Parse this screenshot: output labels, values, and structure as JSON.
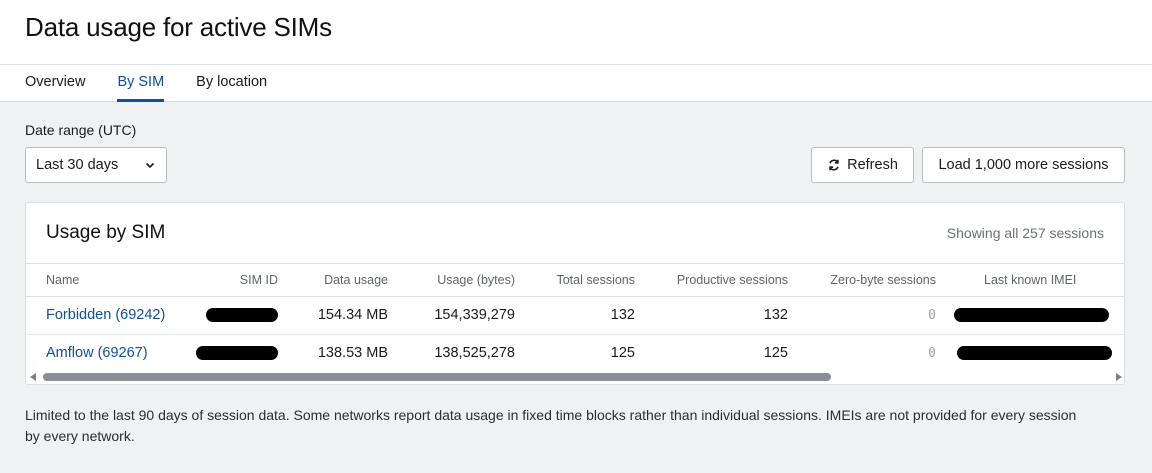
{
  "header": {
    "title": "Data usage for active SIMs"
  },
  "tabs": [
    {
      "label": "Overview"
    },
    {
      "label": "By SIM"
    },
    {
      "label": "By location"
    }
  ],
  "controls": {
    "date_range_label": "Date range (UTC)",
    "date_range_value": "Last 30 days",
    "refresh_label": "Refresh",
    "load_more_label": "Load 1,000 more sessions"
  },
  "card": {
    "title": "Usage by SIM",
    "count_text": "Showing all 257 sessions"
  },
  "table": {
    "columns": [
      "Name",
      "SIM ID",
      "Data usage",
      "Usage (bytes)",
      "Total sessions",
      "Productive sessions",
      "Zero-byte sessions",
      "Last known IMEI"
    ],
    "rows": [
      {
        "name": "Forbidden (69242)",
        "sim_id": "[redacted]",
        "data_usage": "154.34 MB",
        "usage_bytes": "154,339,279",
        "total_sessions": "132",
        "productive_sessions": "132",
        "zero_byte_sessions": "0",
        "imei": "[redacted]"
      },
      {
        "name": "Amflow (69267)",
        "sim_id": "[redacted]",
        "data_usage": "138.53 MB",
        "usage_bytes": "138,525,278",
        "total_sessions": "125",
        "productive_sessions": "125",
        "zero_byte_sessions": "0",
        "imei": "[redacted]"
      }
    ]
  },
  "footnote": "Limited to the last 90 days of session data. Some networks report data usage in fixed time blocks rather than individual sessions. IMEIs are not provided for every session by every network.",
  "colors": {
    "accent": "#0f4f9e",
    "background": "#f0f1f3"
  },
  "icons": {
    "refresh": "refresh-icon",
    "dropdown": "chevron-down-icon"
  }
}
